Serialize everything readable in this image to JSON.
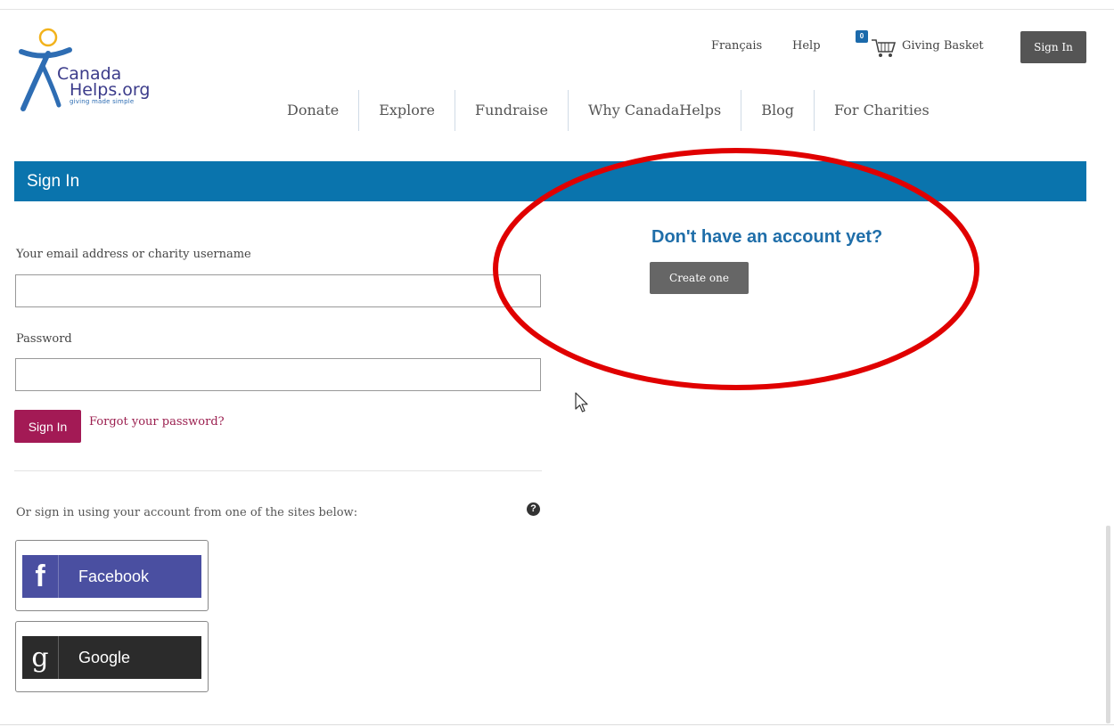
{
  "logo": {
    "line1": "Canada",
    "line2": "Helps.org",
    "tagline": "giving made simple",
    "icon": "canadahelps-figure-logo"
  },
  "utility_nav": {
    "language": "Français",
    "help": "Help",
    "basket_count": "0",
    "basket_label": "Giving Basket",
    "basket_icon": "cart-icon",
    "sign_in": "Sign In"
  },
  "main_nav": {
    "items": [
      "Donate",
      "Explore",
      "Fundraise",
      "Why CanadaHelps",
      "Blog",
      "For Charities"
    ]
  },
  "banner": {
    "title": "Sign In"
  },
  "form": {
    "email_label": "Your email address or charity username",
    "email_value": "",
    "password_label": "Password",
    "password_value": "",
    "submit": "Sign In",
    "forgot": "Forgot your password?",
    "social_hint": "Or sign in using your account from one of the sites below:",
    "help_icon": "?"
  },
  "social": {
    "facebook": {
      "glyph": "f",
      "label": "Facebook",
      "icon": "facebook-icon"
    },
    "google": {
      "glyph": "g",
      "label": "Google",
      "icon": "google-icon"
    }
  },
  "register": {
    "heading": "Don't have an account yet?",
    "button": "Create one"
  },
  "colors": {
    "brand_blue": "#0a74ad",
    "accent_maroon": "#a31a55",
    "annotation_red": "#e00000",
    "facebook": "#4a4fa1"
  }
}
